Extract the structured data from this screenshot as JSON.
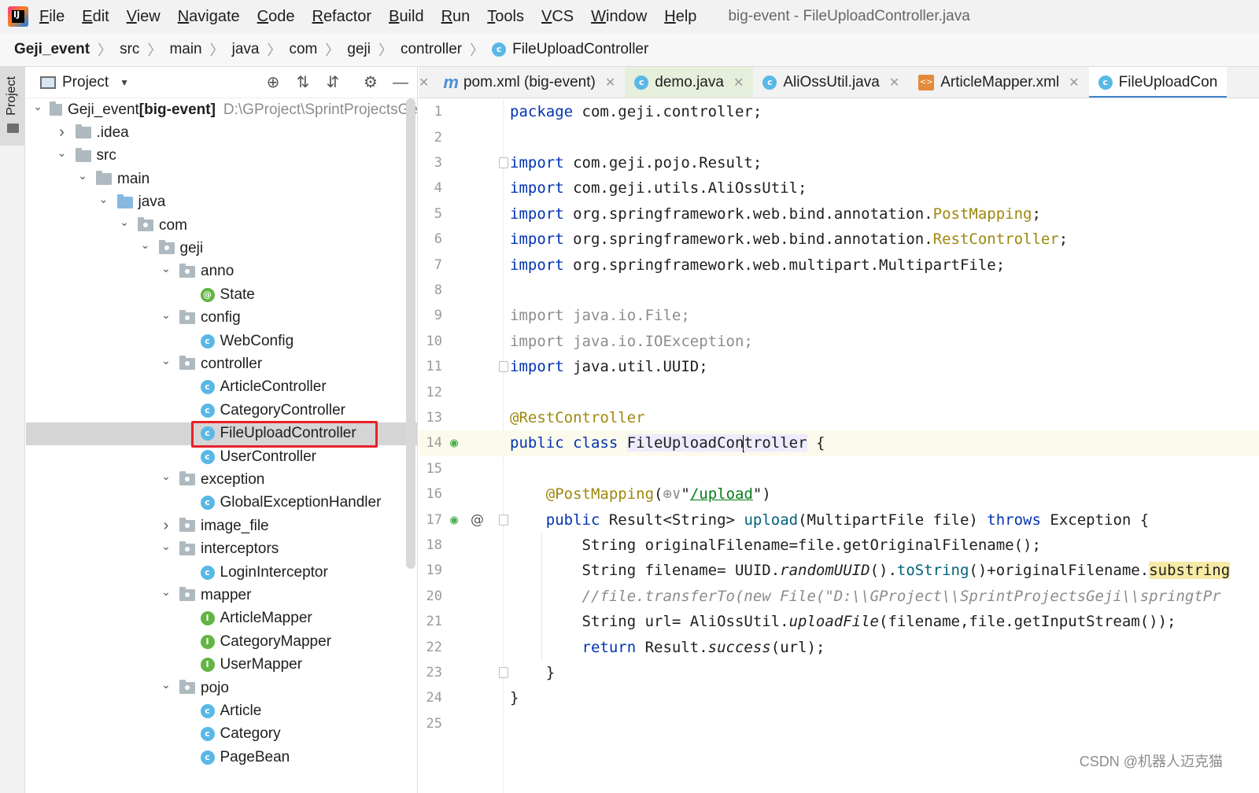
{
  "menubar": {
    "items": [
      "File",
      "Edit",
      "View",
      "Navigate",
      "Code",
      "Refactor",
      "Build",
      "Run",
      "Tools",
      "VCS",
      "Window",
      "Help"
    ],
    "window_title": "big-event - FileUploadController.java"
  },
  "breadcrumb": [
    "Geji_event",
    "src",
    "main",
    "java",
    "com",
    "geji",
    "controller",
    "FileUploadController"
  ],
  "sidebar_strip": {
    "project_label": "Project"
  },
  "project_panel": {
    "title": "Project",
    "tree": [
      {
        "label": "Geji_event",
        "extra": "[big-event]",
        "path": "D:\\GProject\\SprintProjectsGe",
        "depth": 0,
        "kind": "module",
        "expanded": true
      },
      {
        "label": ".idea",
        "depth": 1,
        "kind": "folder",
        "expanded": false
      },
      {
        "label": "src",
        "depth": 1,
        "kind": "folder",
        "expanded": true
      },
      {
        "label": "main",
        "depth": 2,
        "kind": "folder",
        "expanded": true
      },
      {
        "label": "java",
        "depth": 3,
        "kind": "source-folder",
        "expanded": true
      },
      {
        "label": "com",
        "depth": 4,
        "kind": "package",
        "expanded": true
      },
      {
        "label": "geji",
        "depth": 5,
        "kind": "package",
        "expanded": true
      },
      {
        "label": "anno",
        "depth": 6,
        "kind": "package",
        "expanded": true
      },
      {
        "label": "State",
        "depth": 7,
        "kind": "annotation"
      },
      {
        "label": "config",
        "depth": 6,
        "kind": "package",
        "expanded": true
      },
      {
        "label": "WebConfig",
        "depth": 7,
        "kind": "class"
      },
      {
        "label": "controller",
        "depth": 6,
        "kind": "package",
        "expanded": true
      },
      {
        "label": "ArticleController",
        "depth": 7,
        "kind": "class"
      },
      {
        "label": "CategoryController",
        "depth": 7,
        "kind": "class"
      },
      {
        "label": "FileUploadController",
        "depth": 7,
        "kind": "class",
        "selected": true
      },
      {
        "label": "UserController",
        "depth": 7,
        "kind": "class"
      },
      {
        "label": "exception",
        "depth": 6,
        "kind": "package",
        "expanded": true
      },
      {
        "label": "GlobalExceptionHandler",
        "depth": 7,
        "kind": "class"
      },
      {
        "label": "image_file",
        "depth": 6,
        "kind": "package",
        "expanded": false
      },
      {
        "label": "interceptors",
        "depth": 6,
        "kind": "package",
        "expanded": true
      },
      {
        "label": "LoginInterceptor",
        "depth": 7,
        "kind": "class"
      },
      {
        "label": "mapper",
        "depth": 6,
        "kind": "package",
        "expanded": true
      },
      {
        "label": "ArticleMapper",
        "depth": 7,
        "kind": "interface"
      },
      {
        "label": "CategoryMapper",
        "depth": 7,
        "kind": "interface"
      },
      {
        "label": "UserMapper",
        "depth": 7,
        "kind": "interface"
      },
      {
        "label": "pojo",
        "depth": 6,
        "kind": "package",
        "expanded": true
      },
      {
        "label": "Article",
        "depth": 7,
        "kind": "class"
      },
      {
        "label": "Category",
        "depth": 7,
        "kind": "class"
      },
      {
        "label": "PageBean",
        "depth": 7,
        "kind": "class"
      }
    ]
  },
  "editor_tabs": [
    {
      "label": "pom.xml (big-event)",
      "icon": "maven-icon",
      "tinted": false,
      "active": false
    },
    {
      "label": "demo.java",
      "icon": "class-icon",
      "tinted": true,
      "active": false
    },
    {
      "label": "AliOssUtil.java",
      "icon": "class-icon",
      "tinted": false,
      "active": false
    },
    {
      "label": "ArticleMapper.xml",
      "icon": "xml-icon",
      "tinted": false,
      "active": false
    },
    {
      "label": "FileUploadCon",
      "icon": "class-icon",
      "tinted": false,
      "active": true
    }
  ],
  "editor": {
    "current_line": 14,
    "lines": [
      [
        {
          "t": "package ",
          "c": "k"
        },
        {
          "t": "com.geji.controller;"
        }
      ],
      [],
      [
        {
          "t": "import ",
          "c": "k"
        },
        {
          "t": "com.geji.pojo.Result;"
        }
      ],
      [
        {
          "t": "import ",
          "c": "k"
        },
        {
          "t": "com.geji.utils.AliOssUtil;"
        }
      ],
      [
        {
          "t": "import ",
          "c": "k"
        },
        {
          "t": "org.springframework.web.bind.annotation."
        },
        {
          "t": "PostMapping",
          "c": "ann"
        },
        {
          "t": ";"
        }
      ],
      [
        {
          "t": "import ",
          "c": "k"
        },
        {
          "t": "org.springframework.web.bind.annotation."
        },
        {
          "t": "RestController",
          "c": "ann"
        },
        {
          "t": ";"
        }
      ],
      [
        {
          "t": "import ",
          "c": "k"
        },
        {
          "t": "org.springframework.web.multipart.MultipartFile;"
        }
      ],
      [],
      [
        {
          "t": "import java.io.File;",
          "c": "gray"
        }
      ],
      [
        {
          "t": "import java.io.IOException;",
          "c": "gray"
        }
      ],
      [
        {
          "t": "import ",
          "c": "k"
        },
        {
          "t": "java.util.UUID;"
        }
      ],
      [],
      [
        {
          "t": "@RestController",
          "c": "ann"
        }
      ],
      [
        {
          "t": "public class ",
          "c": "k"
        },
        {
          "t": "FileUploadCon",
          "c": "ident-hl"
        },
        {
          "t": "troller",
          "c": "ident-hl"
        },
        {
          "t": " {"
        }
      ],
      [],
      [
        {
          "t": "    "
        },
        {
          "t": "@PostMapping",
          "c": "ann"
        },
        {
          "t": "("
        },
        {
          "t": "⊕∨",
          "c": "gray"
        },
        {
          "t": "\""
        },
        {
          "t": "/upload",
          "c": "link"
        },
        {
          "t": "\")"
        }
      ],
      [
        {
          "t": "    "
        },
        {
          "t": "public ",
          "c": "k"
        },
        {
          "t": "Result<String> "
        },
        {
          "t": "upload",
          "c": "method"
        },
        {
          "t": "(MultipartFile file) "
        },
        {
          "t": "throws ",
          "c": "k"
        },
        {
          "t": "Exception {"
        }
      ],
      [
        {
          "t": "        String originalFilename=file.getOriginalFilename();"
        }
      ],
      [
        {
          "t": "        String filename= UUID."
        },
        {
          "t": "randomUUID",
          "c": "italic"
        },
        {
          "t": "()."
        },
        {
          "t": "toString",
          "c": "method"
        },
        {
          "t": "()+originalFilename."
        },
        {
          "t": "substring",
          "c": "hl-sub"
        }
      ],
      [
        {
          "t": "        "
        },
        {
          "t": "//file.transferTo(new File(\"D:\\\\GProject\\\\SprintProjectsGeji\\\\springtPr",
          "c": "cmt"
        }
      ],
      [
        {
          "t": "        String url= AliOssUtil."
        },
        {
          "t": "uploadFile",
          "c": "italic"
        },
        {
          "t": "(filename,file.getInputStream());"
        }
      ],
      [
        {
          "t": "        "
        },
        {
          "t": "return ",
          "c": "k"
        },
        {
          "t": "Result."
        },
        {
          "t": "success",
          "c": "italic"
        },
        {
          "t": "(url);"
        }
      ],
      [
        {
          "t": "    }"
        }
      ],
      [
        {
          "t": "}"
        }
      ],
      []
    ]
  },
  "watermark": "CSDN @机器人迈克猫"
}
